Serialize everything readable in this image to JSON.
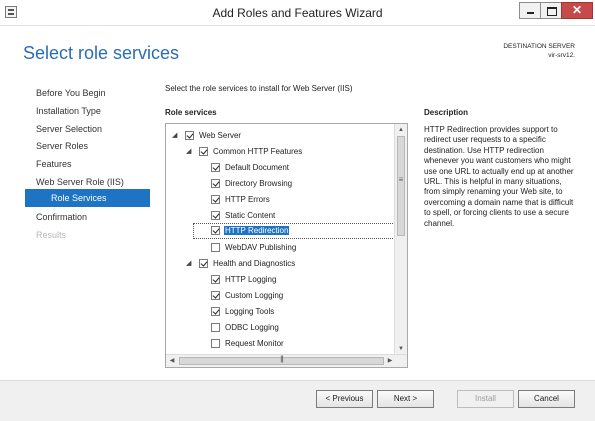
{
  "window": {
    "title": "Add Roles and Features Wizard",
    "close_glyph": "✕"
  },
  "header": {
    "page_title": "Select role services",
    "destination_label": "DESTINATION SERVER",
    "destination_name": "vir-srv12."
  },
  "nav": {
    "items": [
      {
        "label": "Before You Begin"
      },
      {
        "label": "Installation Type"
      },
      {
        "label": "Server Selection"
      },
      {
        "label": "Server Roles"
      },
      {
        "label": "Features"
      },
      {
        "label": "Web Server Role (IIS)"
      },
      {
        "label": "Role Services",
        "selected": true
      },
      {
        "label": "Confirmation"
      },
      {
        "label": "Results",
        "disabled": true
      }
    ]
  },
  "main": {
    "intro": "Select the role services to install for Web Server (IIS)",
    "role_services_heading": "Role services",
    "description_heading": "Description",
    "description_text": "HTTP Redirection provides support to redirect user requests to a specific destination. Use HTTP redirection whenever you want customers who might use one URL to actually end up at another URL. This is helpful in many situations, from simply renaming your Web site, to overcoming a domain name that is difficult to spell, or forcing clients to use a secure channel.",
    "tree": [
      {
        "label": "Web Server",
        "checked": true,
        "expanded": true
      },
      {
        "label": "Common HTTP Features",
        "checked": true,
        "expanded": true
      },
      {
        "label": "Default Document",
        "checked": true
      },
      {
        "label": "Directory Browsing",
        "checked": true
      },
      {
        "label": "HTTP Errors",
        "checked": true
      },
      {
        "label": "Static Content",
        "checked": true
      },
      {
        "label": "HTTP Redirection",
        "checked": true,
        "selected": true
      },
      {
        "label": "WebDAV Publishing",
        "checked": false
      },
      {
        "label": "Health and Diagnostics",
        "checked": true,
        "expanded": true
      },
      {
        "label": "HTTP Logging",
        "checked": true
      },
      {
        "label": "Custom Logging",
        "checked": true
      },
      {
        "label": "Logging Tools",
        "checked": true
      },
      {
        "label": "ODBC Logging",
        "checked": false
      },
      {
        "label": "Request Monitor",
        "checked": false
      }
    ]
  },
  "footer": {
    "previous_label": "< Previous",
    "next_label": "Next >",
    "install_label": "Install",
    "cancel_label": "Cancel"
  },
  "colors": {
    "accent": "#1e73c2",
    "title_blue": "#2a6cb6",
    "close_red": "#c74a4a"
  }
}
